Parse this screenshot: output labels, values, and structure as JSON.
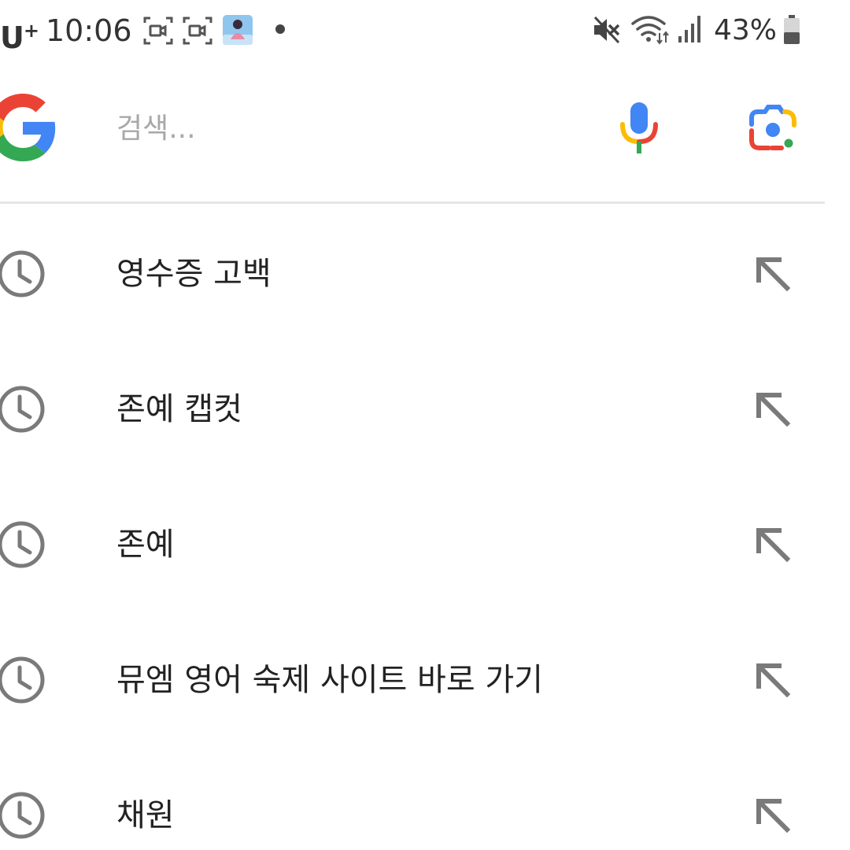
{
  "status_bar": {
    "carrier": "U",
    "carrier_sup": "+",
    "time": "10:06",
    "battery_percent": "43%",
    "icons": [
      "screen-record-icon",
      "screen-record-icon",
      "app-thumbnail-icon",
      "notification-dot-icon",
      "vibrate-mute-icon",
      "wifi-icon",
      "signal-icon",
      "battery-icon"
    ]
  },
  "search": {
    "placeholder": "검색...",
    "value": "",
    "icons": [
      "google-logo-icon",
      "mic-icon",
      "lens-icon"
    ]
  },
  "suggestions": [
    {
      "text": "영수증 고백",
      "icon": "history-icon",
      "action": "fill-arrow-icon"
    },
    {
      "text": "존예 캡컷",
      "icon": "history-icon",
      "action": "fill-arrow-icon"
    },
    {
      "text": "존예",
      "icon": "history-icon",
      "action": "fill-arrow-icon"
    },
    {
      "text": "뮤엠 영어 숙제 사이트 바로 가기",
      "icon": "history-icon",
      "action": "fill-arrow-icon"
    },
    {
      "text": "채원",
      "icon": "history-icon",
      "action": "fill-arrow-icon"
    }
  ],
  "colors": {
    "google_blue": "#4285F4",
    "google_red": "#EA4335",
    "google_yellow": "#FBBC05",
    "google_green": "#34A853",
    "text_primary": "#222222",
    "placeholder": "#a8a8a8",
    "icon_gray": "#7a7a7a"
  }
}
